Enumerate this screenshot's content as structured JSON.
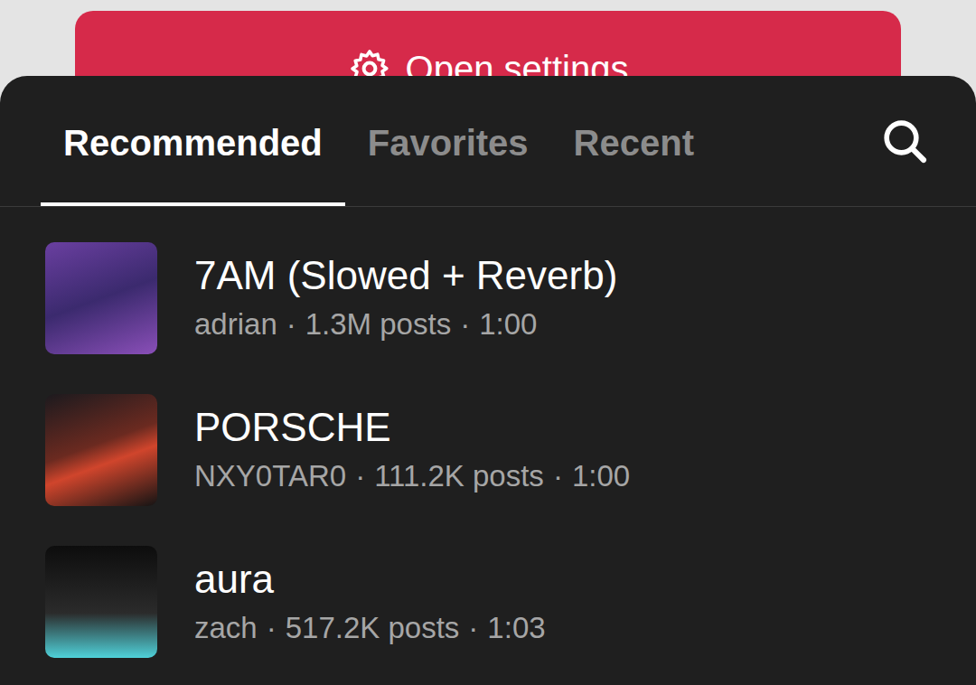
{
  "background_button": {
    "label": "Open settings"
  },
  "tabs": [
    {
      "label": "Recommended",
      "selected": true
    },
    {
      "label": "Favorites",
      "selected": false
    },
    {
      "label": "Recent",
      "selected": false
    }
  ],
  "separator": "·",
  "tracks": [
    {
      "title": "7AM (Slowed + Reverb)",
      "artist": "adrian",
      "posts": "1.3M posts",
      "duration": "1:00"
    },
    {
      "title": "PORSCHE",
      "artist": "NXY0TAR0",
      "posts": "111.2K posts",
      "duration": "1:00"
    },
    {
      "title": "aura",
      "artist": "zach",
      "posts": "517.2K posts",
      "duration": "1:03"
    }
  ]
}
